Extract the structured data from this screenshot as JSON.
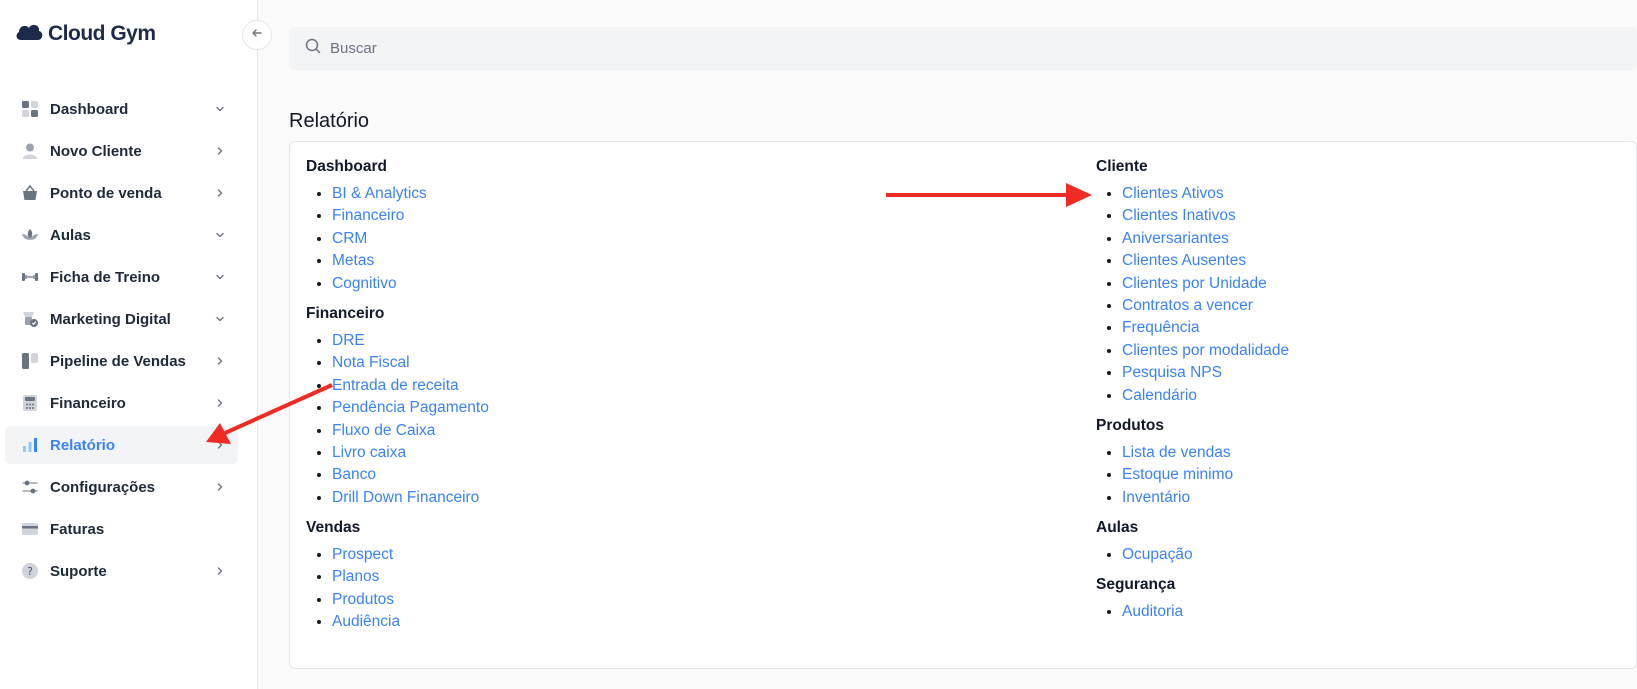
{
  "app": {
    "logo_text": "Cloud Gym"
  },
  "sidebar": {
    "items": [
      {
        "label": "Dashboard",
        "chevron": "down"
      },
      {
        "label": "Novo Cliente",
        "chevron": "right"
      },
      {
        "label": "Ponto de venda",
        "chevron": "right"
      },
      {
        "label": "Aulas",
        "chevron": "down"
      },
      {
        "label": "Ficha de Treino",
        "chevron": "down"
      },
      {
        "label": "Marketing Digital",
        "chevron": "down"
      },
      {
        "label": "Pipeline de Vendas",
        "chevron": "right"
      },
      {
        "label": "Financeiro",
        "chevron": "right"
      },
      {
        "label": "Relatório",
        "chevron": "right",
        "active": true
      },
      {
        "label": "Configurações",
        "chevron": "right"
      },
      {
        "label": "Faturas",
        "chevron": "none"
      },
      {
        "label": "Suporte",
        "chevron": "right"
      }
    ]
  },
  "search": {
    "placeholder": "Buscar",
    "value": ""
  },
  "page": {
    "title": "Relatório"
  },
  "report": {
    "left": [
      {
        "title": "Dashboard",
        "links": [
          "BI & Analytics",
          "Financeiro",
          "CRM",
          "Metas",
          "Cognitivo"
        ]
      },
      {
        "title": "Financeiro",
        "links": [
          "DRE",
          "Nota Fiscal",
          "Entrada de receita",
          "Pendência Pagamento",
          "Fluxo de Caixa",
          "Livro caixa",
          "Banco",
          "Drill Down Financeiro"
        ]
      },
      {
        "title": "Vendas",
        "links": [
          "Prospect",
          "Planos",
          "Produtos",
          "Audiência"
        ]
      }
    ],
    "right": [
      {
        "title": "Cliente",
        "links": [
          "Clientes Ativos",
          "Clientes Inativos",
          "Aniversariantes",
          "Clientes Ausentes",
          "Clientes por Unidade",
          "Contratos a vencer",
          "Frequência",
          "Clientes por modalidade",
          "Pesquisa NPS",
          "Calendário"
        ]
      },
      {
        "title": "Produtos",
        "links": [
          "Lista de vendas",
          "Estoque minimo",
          "Inventário"
        ]
      },
      {
        "title": "Aulas",
        "links": [
          "Ocupação"
        ]
      },
      {
        "title": "Segurança",
        "links": [
          "Auditoria"
        ]
      }
    ]
  },
  "colors": {
    "accent": "#3b82f6",
    "annotation": "#ef2b23",
    "brand": "#1e2a4a"
  }
}
